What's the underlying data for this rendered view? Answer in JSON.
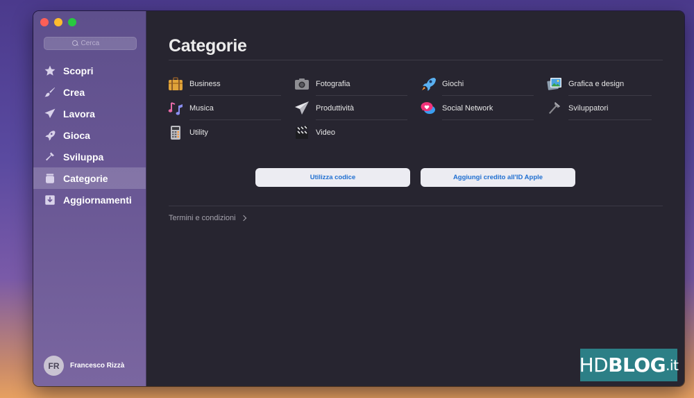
{
  "sidebar": {
    "search_placeholder": "Cerca",
    "items": [
      {
        "label": "Scopri",
        "icon": "star-icon",
        "active": false
      },
      {
        "label": "Crea",
        "icon": "brush-icon",
        "active": false
      },
      {
        "label": "Lavora",
        "icon": "paper-plane-icon",
        "active": false
      },
      {
        "label": "Gioca",
        "icon": "rocket-icon",
        "active": false
      },
      {
        "label": "Sviluppa",
        "icon": "hammer-icon",
        "active": false
      },
      {
        "label": "Categorie",
        "icon": "stack-icon",
        "active": true
      },
      {
        "label": "Aggiornamenti",
        "icon": "download-icon",
        "active": false
      }
    ],
    "user": {
      "initials": "FR",
      "name": "Francesco Rizzà"
    }
  },
  "main": {
    "title": "Categorie",
    "categories": [
      {
        "label": "Business",
        "icon": "briefcase-icon"
      },
      {
        "label": "Fotografia",
        "icon": "camera-icon"
      },
      {
        "label": "Giochi",
        "icon": "rocket-icon"
      },
      {
        "label": "Grafica e design",
        "icon": "picture-icon"
      },
      {
        "label": "Musica",
        "icon": "music-note-icon"
      },
      {
        "label": "Produttività",
        "icon": "paper-plane-icon"
      },
      {
        "label": "Social Network",
        "icon": "chat-heart-icon"
      },
      {
        "label": "Sviluppatori",
        "icon": "hammer-icon"
      },
      {
        "label": "Utility",
        "icon": "calculator-icon"
      },
      {
        "label": "Video",
        "icon": "clapperboard-icon"
      }
    ],
    "buttons": {
      "redeem": "Utilizza codice",
      "add_credit": "Aggiungi credito all'ID Apple"
    },
    "terms": "Termini e condizioni"
  },
  "watermark": {
    "part1": "HD",
    "part2": "BLOG",
    "part3": ".it"
  },
  "colors": {
    "accent": "#1f6fd1",
    "sidebar": "#6a5895",
    "content_bg": "#272530"
  }
}
